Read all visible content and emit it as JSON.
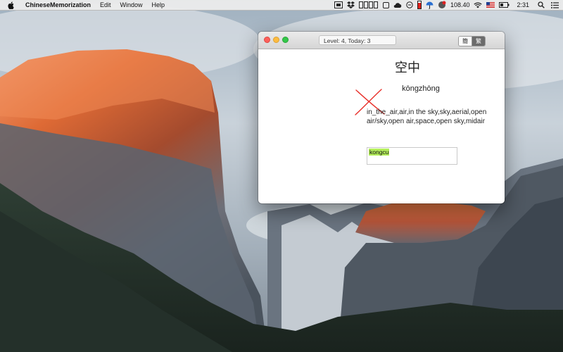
{
  "menubar": {
    "app_name": "ChineseMemorization",
    "items": [
      "Edit",
      "Window",
      "Help"
    ],
    "battery_text": "108.40",
    "time": "2:31"
  },
  "icons": {
    "apple": "apple-logo-icon",
    "status": [
      "screen-recorder-icon",
      "dropbox-icon",
      "column-icons",
      "stop-icon",
      "cloud-icon",
      "circle-status-icon",
      "battery-monitor-icon",
      "umbrella-icon",
      "wifi-icon",
      "us-flag-icon",
      "battery-icon",
      "search-icon",
      "list-icon"
    ]
  },
  "window": {
    "status_text": "Level: 4,  Today: 3",
    "segment": {
      "simplified": "簡",
      "traditional": "繁",
      "selected": "traditional"
    },
    "hanzi": "空中",
    "pinyin": "kōngzhōng",
    "meaning": "in_the_air,air,in the sky,sky,aerial,open air/sky,open air,space,open sky,midair",
    "answer": "kongcu",
    "result": "wrong",
    "mark_color": "#e8302a",
    "highlight_color": "#b4ef5b"
  }
}
